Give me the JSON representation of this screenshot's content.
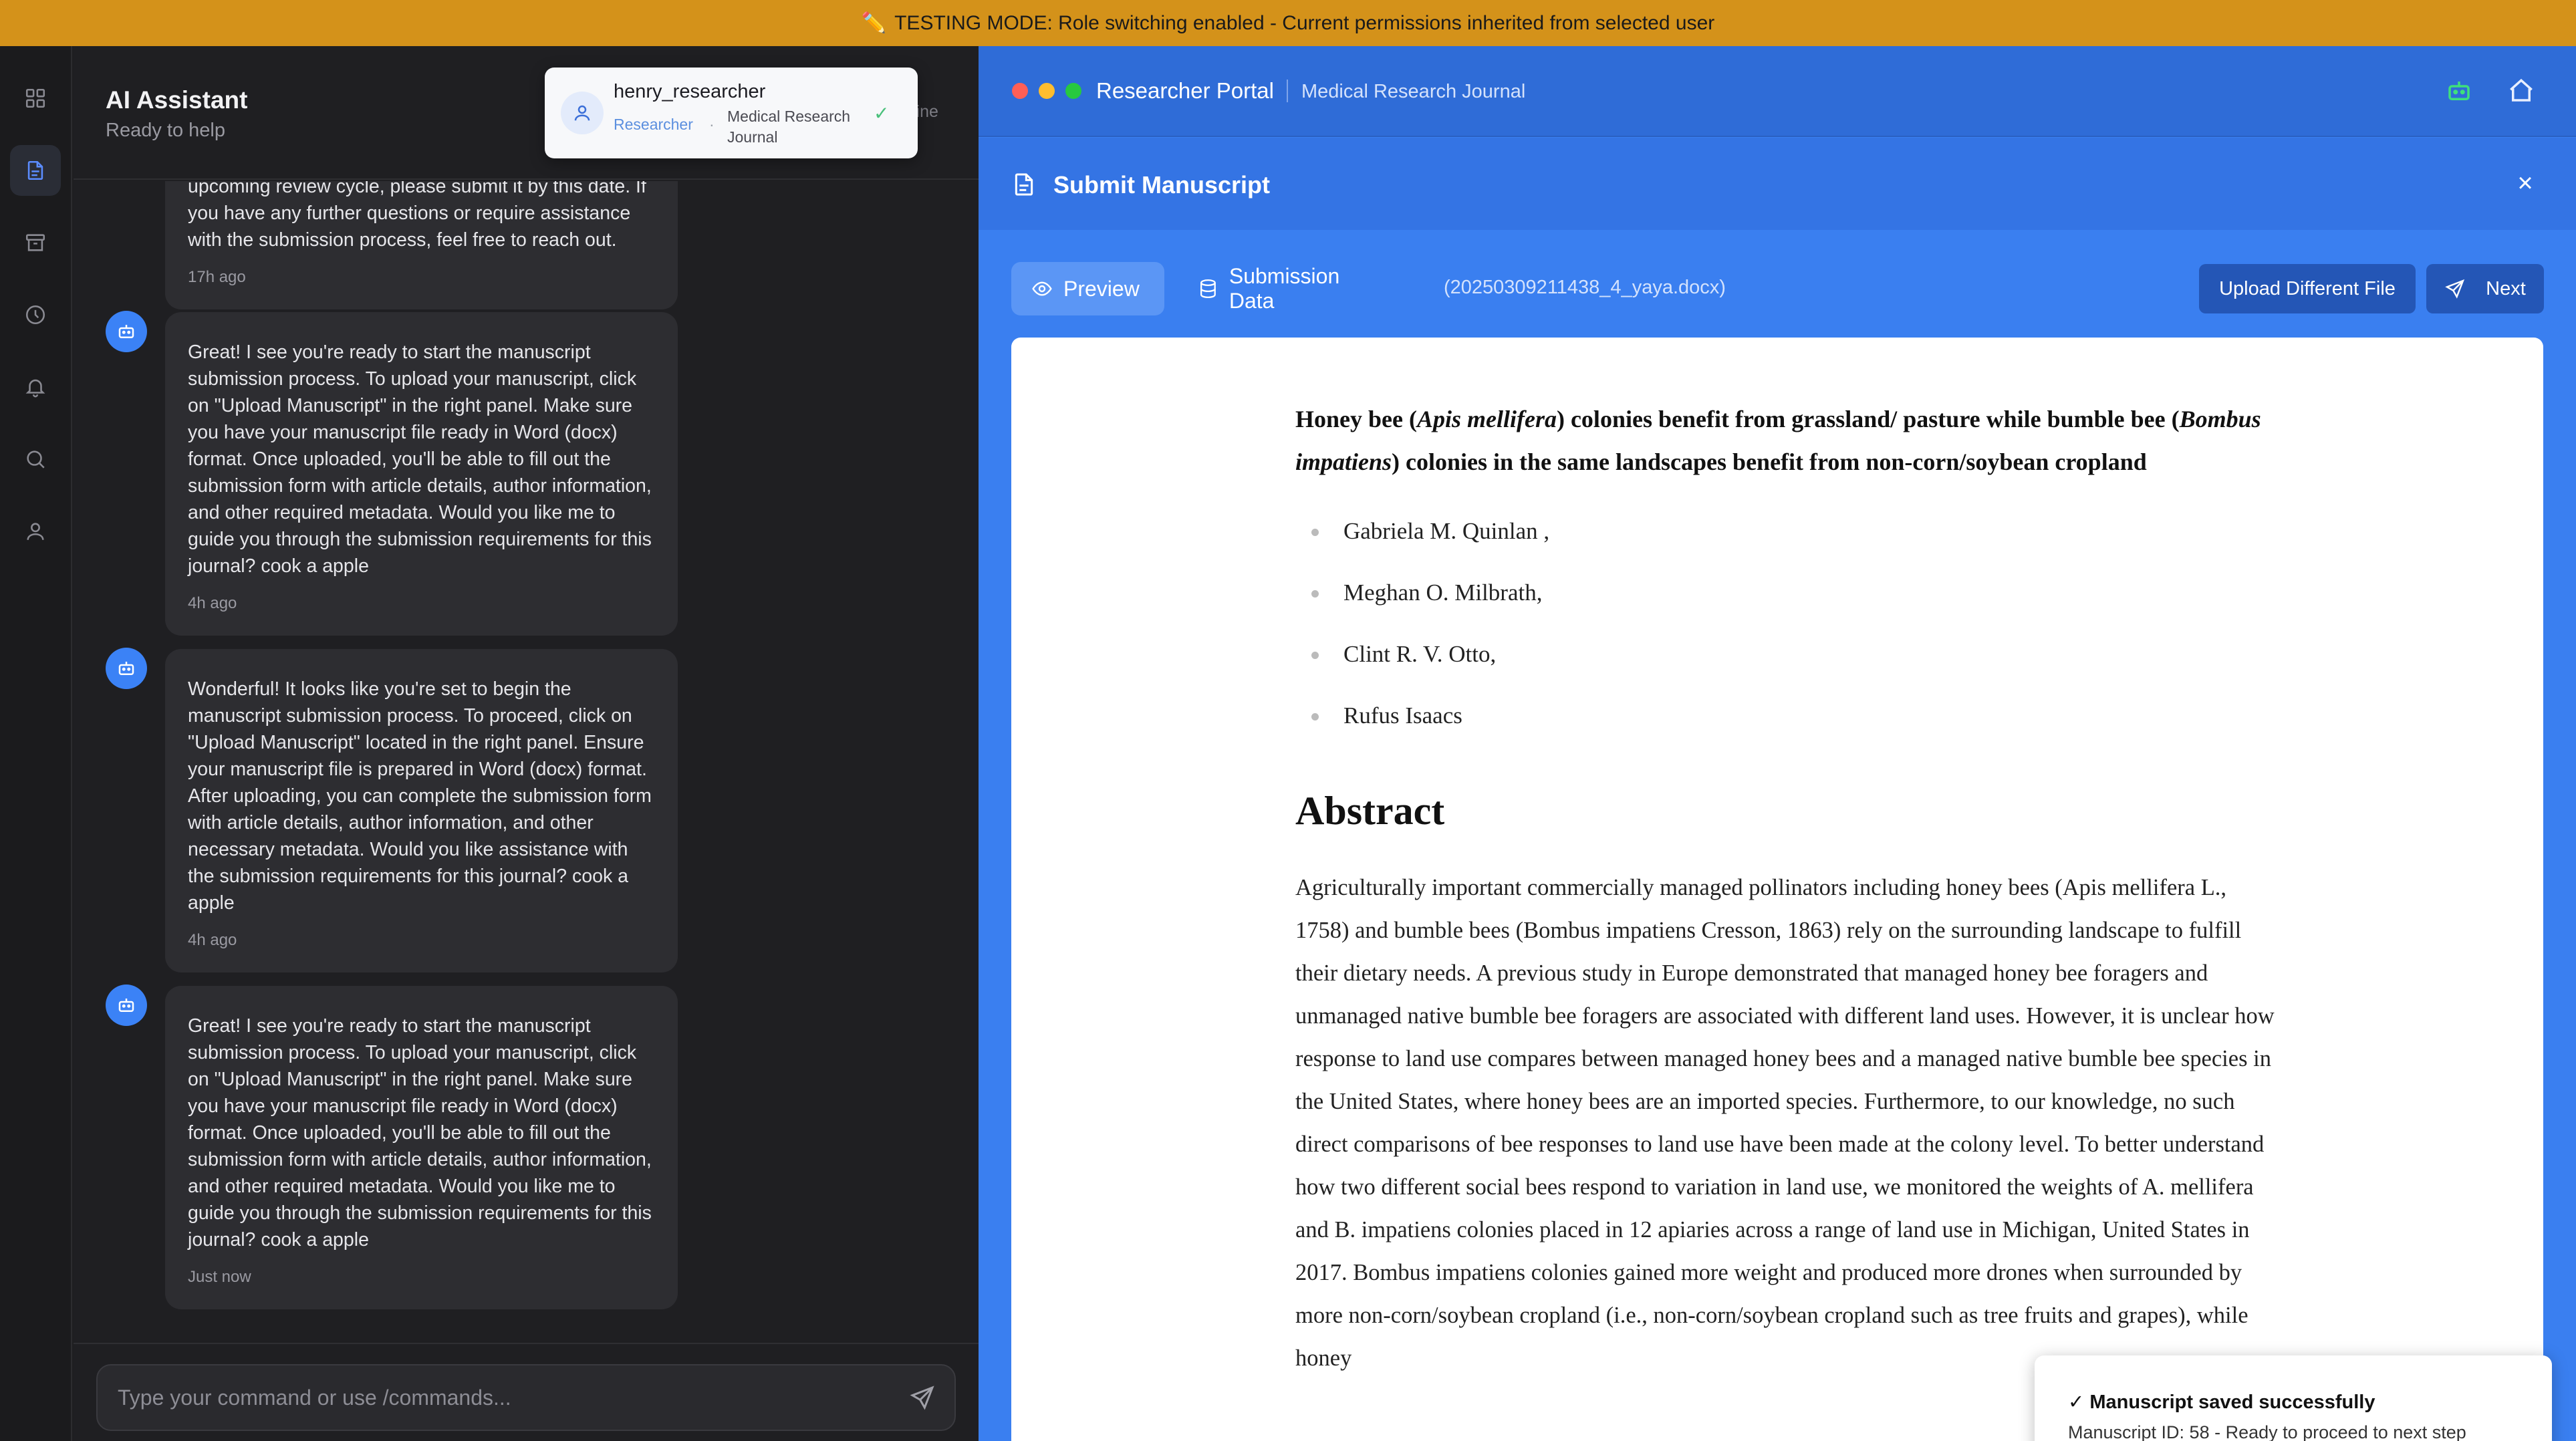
{
  "banner": {
    "icon": "pencil-icon",
    "text": "TESTING MODE: Role switching enabled - Current permissions inherited from selected user"
  },
  "rail": {
    "items": [
      {
        "icon": "dashboard-icon"
      },
      {
        "icon": "document-icon",
        "active": true
      },
      {
        "icon": "archive-icon"
      },
      {
        "icon": "clock-icon"
      },
      {
        "icon": "bell-icon"
      },
      {
        "icon": "search-icon"
      },
      {
        "icon": "user-icon"
      }
    ]
  },
  "chat": {
    "title": "AI Assistant",
    "subtitle": "Ready to help",
    "status_peek": "line",
    "input_placeholder": "Type your command or use /commands...",
    "messages": [
      {
        "text": "upcoming review cycle, please submit it by this date. If you have any further questions or require assistance with the submission process, feel free to reach out.",
        "time": "17h ago"
      },
      {
        "text": "Great! I see you're ready to start the manuscript submission process. To upload your manuscript, click on \"Upload Manuscript\" in the right panel. Make sure you have your manuscript file ready in Word (docx) format. Once uploaded, you'll be able to fill out the submission form with article details, author information, and other required metadata. Would you like me to guide you through the submission requirements for this journal? cook a apple",
        "time": "4h ago"
      },
      {
        "text": "Wonderful! It looks like you're set to begin the manuscript submission process. To proceed, click on \"Upload Manuscript\" located in the right panel. Ensure your manuscript file is prepared in Word (docx) format. After uploading, you can complete the submission form with article details, author information, and other necessary metadata. Would you like assistance with the submission requirements for this journal? cook a apple",
        "time": "4h ago"
      },
      {
        "text": "Great! I see you're ready to start the manuscript submission process. To upload your manuscript, click on \"Upload Manuscript\" in the right panel. Make sure you have your manuscript file ready in Word (docx) format. Once uploaded, you'll be able to fill out the submission form with article details, author information, and other required metadata. Would you like me to guide you through the submission requirements for this journal? cook a apple",
        "time": "Just now"
      }
    ]
  },
  "user_card": {
    "username": "henry_researcher",
    "role": "Researcher",
    "separator": "·",
    "journal": "Medical Research Journal",
    "check": "✓"
  },
  "portal": {
    "name": "Researcher Portal",
    "journal": "Medical Research Journal",
    "header_title": "Submit Manuscript",
    "close": "×",
    "tabs": [
      {
        "label": "Preview",
        "icon": "eye-icon",
        "active": true
      },
      {
        "label": "Submission Data",
        "icon": "database-icon",
        "active": false
      }
    ],
    "filename": "(20250309211438_4_yaya.docx)",
    "upload_label": "Upload Different File",
    "next_label": "Next"
  },
  "document": {
    "title_parts": {
      "p1": "Honey bee (",
      "i1": "Apis mellifera",
      "p2": ") colonies benefit from grassland/ pasture while bumble bee (",
      "i2": "Bombus impatiens",
      "p3": ") colonies in the same landscapes benefit from non-corn/soybean cropland"
    },
    "authors": [
      "Gabriela M. Quinlan ,",
      "Meghan O. Milbrath,",
      "Clint R. V. Otto,",
      "Rufus Isaacs"
    ],
    "abstract_heading": "Abstract",
    "abstract_text": "Agriculturally important commercially managed pollinators including honey bees (Apis mellifera L., 1758) and bumble bees (Bombus impatiens Cresson, 1863) rely on the surrounding landscape to fulfill their dietary needs. A previous study in Europe demonstrated that managed honey bee foragers and unmanaged native bumble bee foragers are associated with different land uses. However, it is unclear how response to land use compares between managed honey bees and a managed native bumble bee species in the United States, where honey bees are an imported species. Furthermore, to our knowledge, no such direct comparisons of bee responses to land use have been made at the colony level. To better understand how two different social bees respond to variation in land use, we monitored the weights of A. mellifera and B. impatiens colonies placed in 12 apiaries across a range of land use in Michigan, United States in 2017. Bombus impatiens colonies gained more weight and produced more drones when surrounded by more non-corn/soybean cropland (i.e., non-corn/soybean cropland such as tree fruits and grapes), while honey"
  },
  "toast": {
    "title": "✓ Manuscript saved successfully",
    "subtitle": "Manuscript ID: 58 - Ready to proceed to next step"
  }
}
